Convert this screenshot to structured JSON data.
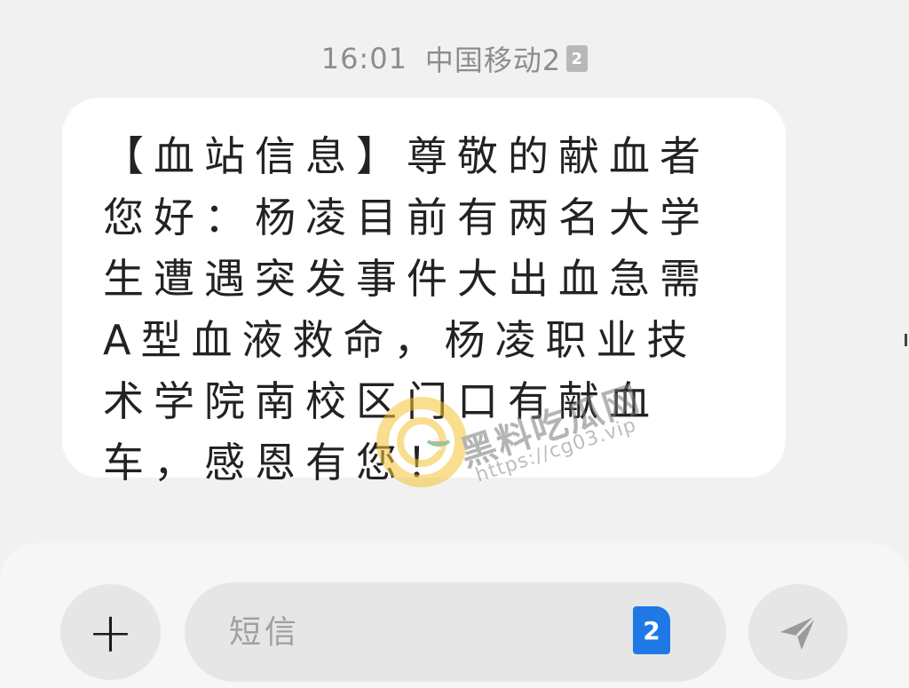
{
  "status": {
    "time": "16:01",
    "carrier": "中国移动2",
    "sim_badge": "2"
  },
  "message": {
    "text": "【血站信息】尊敬的献血者您好：杨凌目前有两名大学生遭遇突发事件大出血急需A型血液救命，杨凌职业技术学院南校区门口有献血车，感恩有您！"
  },
  "watermark": {
    "text": "黑料吃瓜网",
    "url": "https://cg03.vip"
  },
  "composer": {
    "add_label": "+",
    "placeholder": "短信",
    "sim_selector": "2"
  },
  "colors": {
    "background": "#f1f1f1",
    "bubble": "#ffffff",
    "sim_blue": "#1f78e6",
    "button_bg": "#e6e6e6"
  }
}
